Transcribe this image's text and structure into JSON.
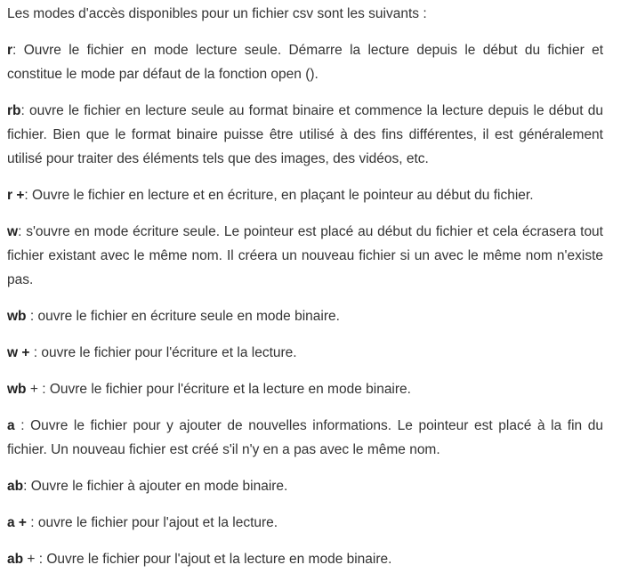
{
  "intro": "Les modes d'accès disponibles pour un fichier csv sont les suivants :",
  "modes": [
    {
      "key": "r",
      "sep": ": ",
      "text": "Ouvre le fichier en mode lecture seule. Démarre la lecture depuis le début du fichier et constitue le mode par défaut de la fonction open ()."
    },
    {
      "key": "rb",
      "sep": ": ",
      "text": "ouvre le fichier en lecture seule au format binaire et commence la lecture depuis le début du fichier. Bien que le format binaire puisse être utilisé à des fins différentes, il est généralement utilisé pour traiter des éléments tels que des images, des vidéos, etc."
    },
    {
      "key": "r +",
      "sep": ": ",
      "text": "Ouvre le fichier en lecture et en écriture, en plaçant le pointeur au début du fichier."
    },
    {
      "key": "w",
      "sep": ": ",
      "text": "s'ouvre en mode écriture seule. Le pointeur est placé au début du fichier et cela écrasera tout fichier existant avec le même nom. Il créera un nouveau fichier si un avec le même nom n'existe pas."
    },
    {
      "key": "wb",
      "sep": " : ",
      "text": "ouvre le fichier en écriture seule en mode binaire."
    },
    {
      "key": "w +",
      "sep": " : ",
      "text": "ouvre le fichier pour l'écriture et la lecture."
    },
    {
      "key": "wb",
      "sep": " + : ",
      "text": "Ouvre le fichier pour l'écriture et la lecture en mode binaire."
    },
    {
      "key": "a",
      "sep": " : ",
      "text": "Ouvre le fichier pour y ajouter de nouvelles informations. Le pointeur est placé à la fin du fichier. Un nouveau fichier est créé s'il n'y en a pas avec le même nom."
    },
    {
      "key": "ab",
      "sep": ": ",
      "text": "Ouvre le fichier à ajouter en mode binaire."
    },
    {
      "key": "a +",
      "sep": " : ",
      "text": "ouvre le fichier pour l'ajout et la lecture."
    },
    {
      "key": "ab",
      "sep": " + : ",
      "text": "Ouvre le fichier pour l'ajout et la lecture en mode binaire."
    }
  ]
}
